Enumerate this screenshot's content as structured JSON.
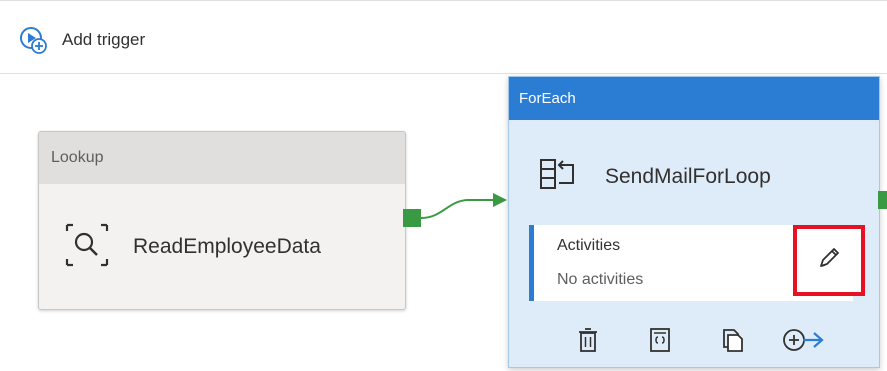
{
  "toolbar": {
    "add_trigger_label": "Add trigger",
    "add_trigger_icon": "trigger-add-icon"
  },
  "lookup_activity": {
    "type_label": "Lookup",
    "name": "ReadEmployeeData",
    "icon": "lookup-icon"
  },
  "foreach_activity": {
    "type_label": "ForEach",
    "name": "SendMailForLoop",
    "icon": "foreach-icon",
    "activities": {
      "label": "Activities",
      "empty_text": "No activities",
      "edit_icon": "pencil-icon"
    },
    "actions": [
      "delete-icon",
      "code-icon",
      "copy-icon",
      "add-output-icon"
    ]
  },
  "colors": {
    "accent": "#2b7cd3",
    "success_port": "#3a9a43",
    "highlight": "#e81123",
    "container_bg": "#deecf9"
  }
}
